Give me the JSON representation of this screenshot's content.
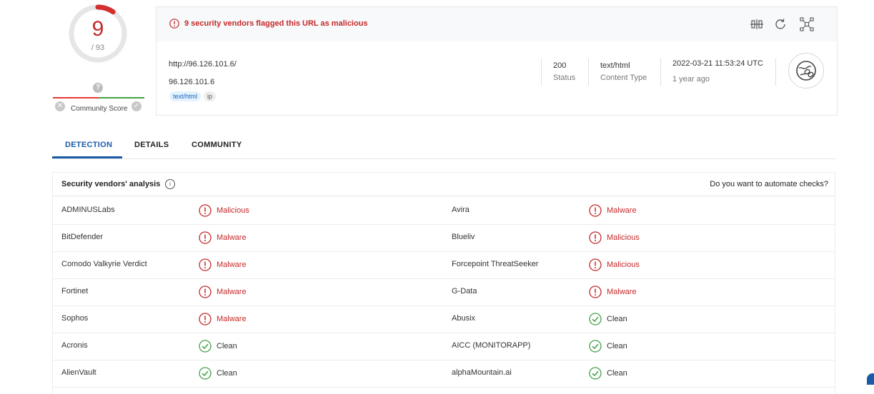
{
  "score": {
    "detections": "9",
    "total": "/ 93",
    "fraction": 0.097
  },
  "community": {
    "label": "Community Score",
    "question": "?"
  },
  "alert": {
    "text": "9 security vendors flagged this URL as malicious"
  },
  "summary": {
    "url": "http://96.126.101.6/",
    "host": "96.126.101.6",
    "tags": [
      "text/html",
      "ip"
    ],
    "status_value": "200",
    "status_label": "Status",
    "content_type_value": "text/html",
    "content_type_label": "Content Type",
    "date": "2022-03-21 11:53:24 UTC",
    "ago": "1 year ago"
  },
  "tabs": [
    "DETECTION",
    "DETAILS",
    "COMMUNITY"
  ],
  "table": {
    "title": "Security vendors' analysis",
    "automate": "Do you want to automate checks?",
    "rows": [
      {
        "left": {
          "vendor": "ADMINUSLabs",
          "result": "Malicious",
          "status": "bad"
        },
        "right": {
          "vendor": "Avira",
          "result": "Malware",
          "status": "bad"
        }
      },
      {
        "left": {
          "vendor": "BitDefender",
          "result": "Malware",
          "status": "bad"
        },
        "right": {
          "vendor": "Blueliv",
          "result": "Malicious",
          "status": "bad"
        }
      },
      {
        "left": {
          "vendor": "Comodo Valkyrie Verdict",
          "result": "Malware",
          "status": "bad"
        },
        "right": {
          "vendor": "Forcepoint ThreatSeeker",
          "result": "Malicious",
          "status": "bad"
        }
      },
      {
        "left": {
          "vendor": "Fortinet",
          "result": "Malware",
          "status": "bad"
        },
        "right": {
          "vendor": "G-Data",
          "result": "Malware",
          "status": "bad"
        }
      },
      {
        "left": {
          "vendor": "Sophos",
          "result": "Malware",
          "status": "bad"
        },
        "right": {
          "vendor": "Abusix",
          "result": "Clean",
          "status": "good"
        }
      },
      {
        "left": {
          "vendor": "Acronis",
          "result": "Clean",
          "status": "good"
        },
        "right": {
          "vendor": "AICC (MONITORAPP)",
          "result": "Clean",
          "status": "good"
        }
      },
      {
        "left": {
          "vendor": "AlienVault",
          "result": "Clean",
          "status": "good"
        },
        "right": {
          "vendor": "alphaMountain.ai",
          "result": "Clean",
          "status": "good"
        }
      }
    ]
  },
  "colors": {
    "malicious": "#c62828",
    "clean": "#43a047",
    "accent": "#1a5ba8"
  },
  "icons": {
    "alert": "alert-circle-icon",
    "header_actions": [
      "compare-icon",
      "reanalyze-icon",
      "graph-icon"
    ],
    "globe": "globe-link-icon"
  }
}
